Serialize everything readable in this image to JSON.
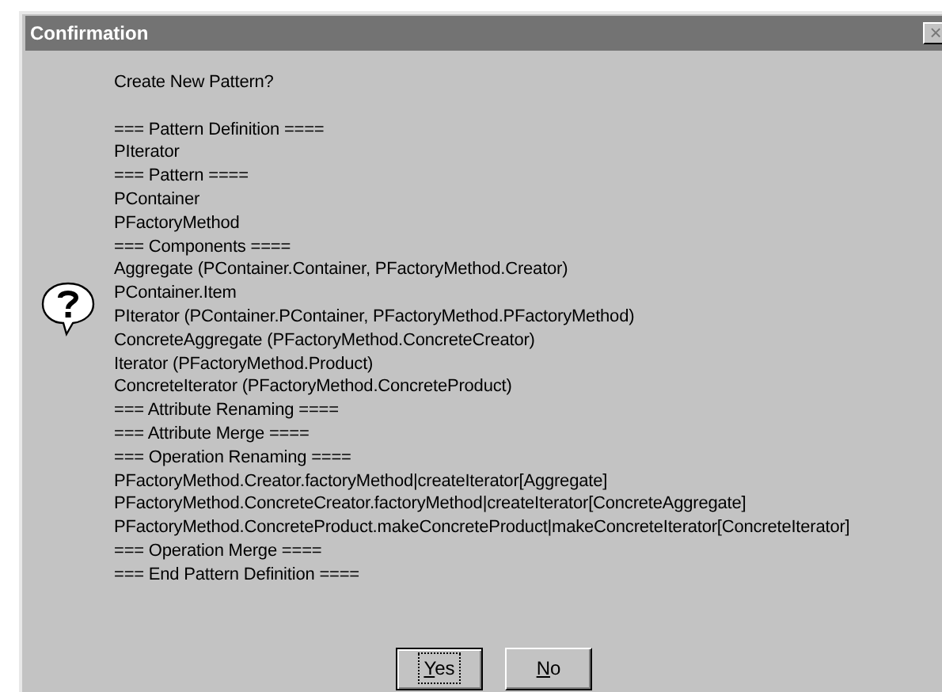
{
  "window": {
    "title": "Confirmation",
    "close": "×"
  },
  "message": {
    "heading": "Create New Pattern?",
    "lines": [
      "=== Pattern Definition ====",
      "PIterator",
      "=== Pattern ====",
      "PContainer",
      "PFactoryMethod",
      "=== Components ====",
      "Aggregate (PContainer.Container, PFactoryMethod.Creator)",
      "PContainer.Item",
      "PIterator (PContainer.PContainer, PFactoryMethod.PFactoryMethod)",
      "ConcreteAggregate (PFactoryMethod.ConcreteCreator)",
      "Iterator (PFactoryMethod.Product)",
      "ConcreteIterator (PFactoryMethod.ConcreteProduct)",
      "=== Attribute Renaming ====",
      "=== Attribute Merge ====",
      "=== Operation Renaming ====",
      "PFactoryMethod.Creator.factoryMethod|createIterator[Aggregate]",
      "PFactoryMethod.ConcreteCreator.factoryMethod|createIterator[ConcreteAggregate]",
      "PFactoryMethod.ConcreteProduct.makeConcreteProduct|makeConcreteIterator[ConcreteIterator]",
      "=== Operation Merge ====",
      "=== End Pattern Definition ===="
    ]
  },
  "buttons": [
    {
      "label": "Yes",
      "selected": true
    },
    {
      "label": "No",
      "selected": false
    }
  ]
}
